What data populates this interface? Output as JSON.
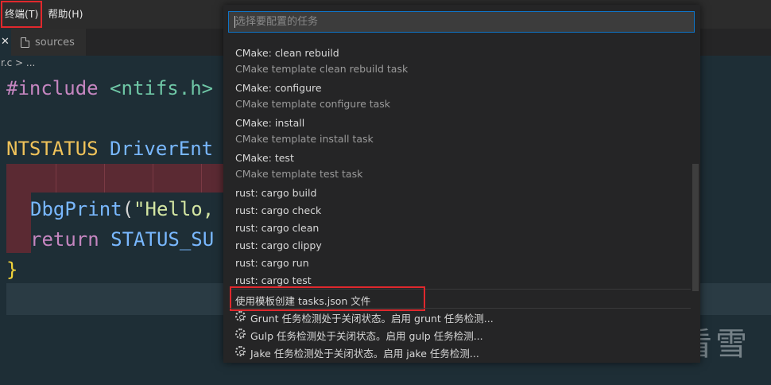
{
  "menubar": {
    "items": [
      {
        "label": "终端(T)",
        "highlight": true
      },
      {
        "label": "帮助(H)",
        "highlight": false
      }
    ]
  },
  "tabs": {
    "close_glyph": "✕",
    "active_label": "sources"
  },
  "breadcrumb": {
    "text": "r.c > ..."
  },
  "editor": {
    "lines": [
      {
        "parts": [
          "#include",
          " ",
          "<ntifs.h>"
        ]
      },
      {
        "parts": [
          "NTSTATUS",
          " ",
          "DriverEnt"
        ]
      },
      {
        "parts": [
          "DbgPrint",
          "(",
          "\"Hello,"
        ]
      },
      {
        "parts": [
          "return",
          " ",
          "STATUS_SU"
        ]
      },
      {
        "parts": [
          "}"
        ]
      }
    ]
  },
  "quickpick": {
    "placeholder": "选择要配置的任务",
    "items": [
      {
        "label": "CMake: clean rebuild",
        "desc": "CMake template clean rebuild task"
      },
      {
        "label": "CMake: configure",
        "desc": "CMake template configure task"
      },
      {
        "label": "CMake: install",
        "desc": "CMake template install task"
      },
      {
        "label": "CMake: test",
        "desc": "CMake template test task"
      },
      {
        "label": "rust: cargo build"
      },
      {
        "label": "rust: cargo check"
      },
      {
        "label": "rust: cargo clean"
      },
      {
        "label": "rust: cargo clippy"
      },
      {
        "label": "rust: cargo run"
      },
      {
        "label": "rust: cargo test"
      },
      {
        "label": "使用模板创建 tasks.json 文件"
      },
      {
        "label": "Grunt 任务检测处于关闭状态。启用 grunt 任务检测..."
      },
      {
        "label": "Gulp 任务检测处于关闭状态。启用 gulp 任务检测..."
      },
      {
        "label": "Jake 任务检测处于关闭状态。启用 jake 任务检测..."
      }
    ]
  },
  "watermark": {
    "text": "看雪",
    "icon": "snowflake-icon"
  },
  "colors": {
    "accent_border": "#0e74c7",
    "highlight_box": "#e0282d",
    "error_bg": "#5b2a33"
  }
}
